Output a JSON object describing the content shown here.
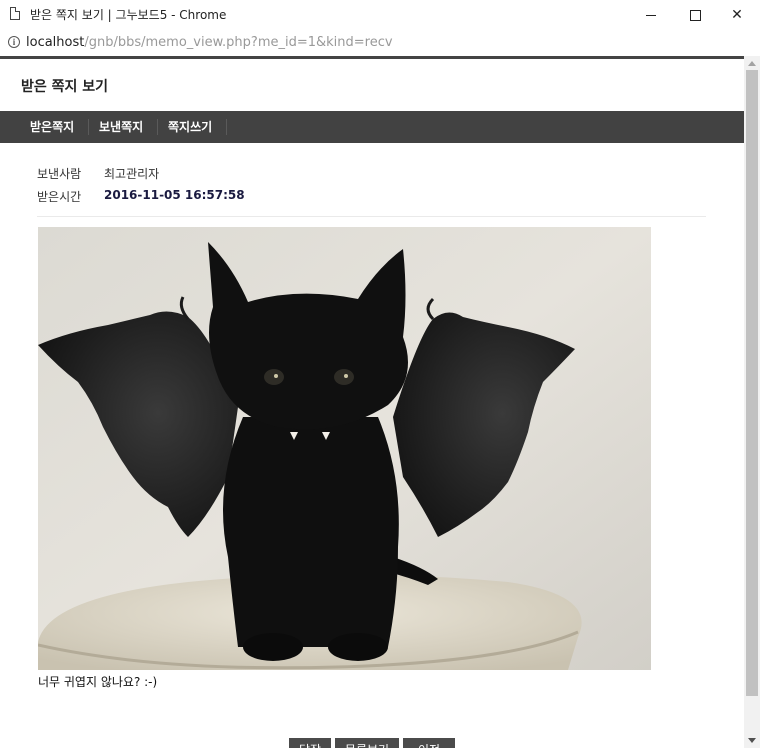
{
  "window": {
    "title": "받은 쪽지 보기 | 그누보드5 - Chrome",
    "controls": {
      "minimize": "minimize",
      "maximize": "maximize",
      "close": "✕"
    }
  },
  "address": {
    "host": "localhost",
    "path": "/gnb/bbs/memo_view.php?me_id=1&kind=recv"
  },
  "page": {
    "title": "받은 쪽지 보기",
    "tabs": [
      "받은쪽지",
      "보낸쪽지",
      "쪽지쓰기"
    ],
    "sender_label": "보낸사람",
    "sender_value": "최고관리자",
    "time_label": "받은시간",
    "time_value": "2016-11-05 16:57:58",
    "image_subject": "black kitten with bat wings",
    "message": "너무 귀엽지 않나요? :-)",
    "buttons": [
      "답장",
      "목록보기",
      "이전"
    ]
  },
  "colors": {
    "tabbar": "#424242",
    "button": "#4b4b4b",
    "date_text": "#1a1a40"
  },
  "icons": [
    "page-icon",
    "info-icon",
    "minimize-icon",
    "maximize-icon",
    "close-icon"
  ]
}
